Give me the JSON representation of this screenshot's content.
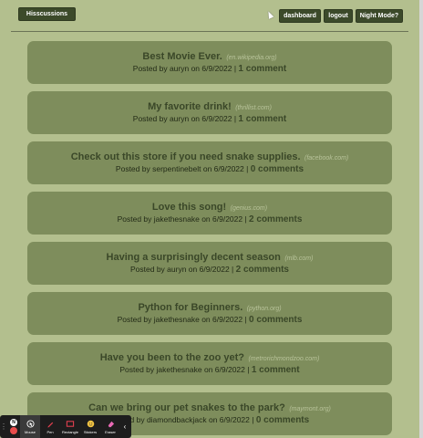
{
  "header": {
    "site_title": "Hisscussions",
    "nav": {
      "dashboard": "dashboard",
      "logout": "logout",
      "night_mode": "Night Mode?"
    }
  },
  "posts": [
    {
      "title": "Best Movie Ever.",
      "domain": "(en.wikipedia.org)",
      "meta": "Posted by auryn on 6/9/2022 |",
      "comments": "1 comment"
    },
    {
      "title": "My favorite drink!",
      "domain": "(thrillist.com)",
      "meta": "Posted by auryn on 6/9/2022 |",
      "comments": "1 comment"
    },
    {
      "title": "Check out this store if you need snake supplies.",
      "domain": "(facebook.com)",
      "meta": "Posted by serpentinebelt on 6/9/2022 |",
      "comments": "0 comments"
    },
    {
      "title": "Love this song!",
      "domain": "(genius.com)",
      "meta": "Posted by jakethesnake on 6/9/2022 |",
      "comments": "2 comments"
    },
    {
      "title": "Having a surprisingly decent season",
      "domain": "(mlb.com)",
      "meta": "Posted by auryn on 6/9/2022 |",
      "comments": "2 comments"
    },
    {
      "title": "Python for Beginners.",
      "domain": "(python.org)",
      "meta": "Posted by jakethesnake on 6/9/2022 |",
      "comments": "0 comments"
    },
    {
      "title": "Have you been to the zoo yet?",
      "domain": "(metrorichmondzoo.com)",
      "meta": "Posted by jakethesnake on 6/9/2022 |",
      "comments": "1 comment"
    },
    {
      "title": "Can we bring our pet snakes to the park?",
      "domain": "(maymont.org)",
      "meta": "Posted by diamondbackjack on 6/9/2022 |",
      "comments": "0 comments"
    }
  ],
  "toolbar": {
    "circle_top": "N",
    "tools": [
      {
        "label": "Mouse",
        "icon": "mouse-icon"
      },
      {
        "label": "Pen",
        "icon": "pen-icon"
      },
      {
        "label": "Rectangle",
        "icon": "rectangle-icon"
      },
      {
        "label": "Stickers",
        "icon": "sticker-icon"
      },
      {
        "label": "Eraser",
        "icon": "eraser-icon"
      }
    ]
  },
  "colors": {
    "background": "#b3bf8e",
    "card": "#7e8d5c",
    "button": "#3c4a2a",
    "title_text": "#3a4728",
    "domain_text": "#b8c39a"
  }
}
